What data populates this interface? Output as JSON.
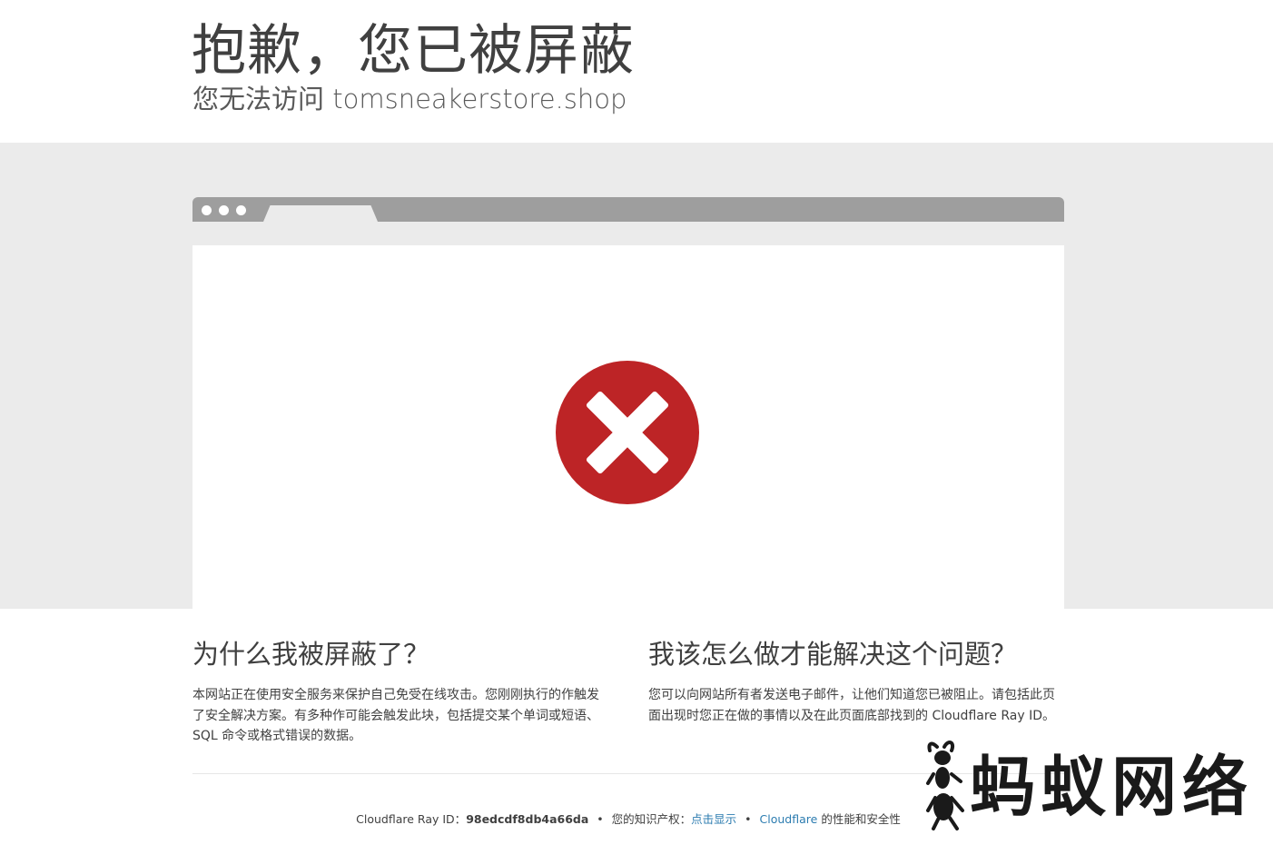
{
  "header": {
    "title": "抱歉，您已被屏蔽",
    "subtitle": "您无法访问 tomsneakerstore.shop"
  },
  "icons": {
    "error": "error-x-icon"
  },
  "colors": {
    "error_red": "#bd2426",
    "link_blue": "#2c7cb0",
    "band_gray": "#ebebeb",
    "browser_bar_gray": "#9e9e9e"
  },
  "why": {
    "title": "为什么我被屏蔽了？",
    "text": "本网站正在使用安全服务来保护自己免受在线攻击。您刚刚执行的作触发了安全解决方案。有多种作可能会触发此块，包括提交某个单词或短语、SQL 命令或格式错误的数据。"
  },
  "solve": {
    "title": "我该怎么做才能解决这个问题？",
    "text": "您可以向网站所有者发送电子邮件，让他们知道您已被阻止。请包括此页面出现时您正在做的事情以及在此页面底部找到的 Cloudflare Ray ID。"
  },
  "footer": {
    "ray_label": "Cloudflare Ray ID：",
    "ray_id": "98edcdf8db4a66da",
    "ip_label": "您的知识产权：",
    "ip_link": "点击显示",
    "cf_link": "Cloudflare",
    "perf_text": "的性能和安全性"
  },
  "watermark": {
    "text": "蚂蚁网络"
  }
}
